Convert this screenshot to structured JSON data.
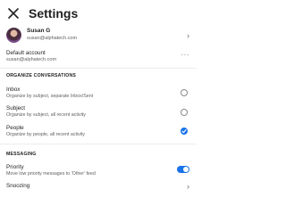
{
  "header": {
    "title": "Settings"
  },
  "profile": {
    "name": "Susan G",
    "email": "susan@alphatech.com"
  },
  "default_account": {
    "label": "Default account",
    "value": "susan@alphatech.com"
  },
  "organize": {
    "heading": "ORGANIZE CONVERSATIONS",
    "options": [
      {
        "title": "Inbox",
        "subtitle": "Organize by subject, separate Inbox/Sent",
        "selected": false
      },
      {
        "title": "Subject",
        "subtitle": "Organize by subject, all recent activity",
        "selected": false
      },
      {
        "title": "People",
        "subtitle": "Organize by people, all recent activity",
        "selected": true
      }
    ]
  },
  "messaging": {
    "heading": "MESSAGING",
    "priority": {
      "title": "Priority",
      "subtitle": "Move low priority messages to 'Other' feed",
      "enabled": true
    },
    "snoozing": {
      "title": "Snoozing"
    }
  },
  "colors": {
    "accent": "#1a73e8"
  }
}
